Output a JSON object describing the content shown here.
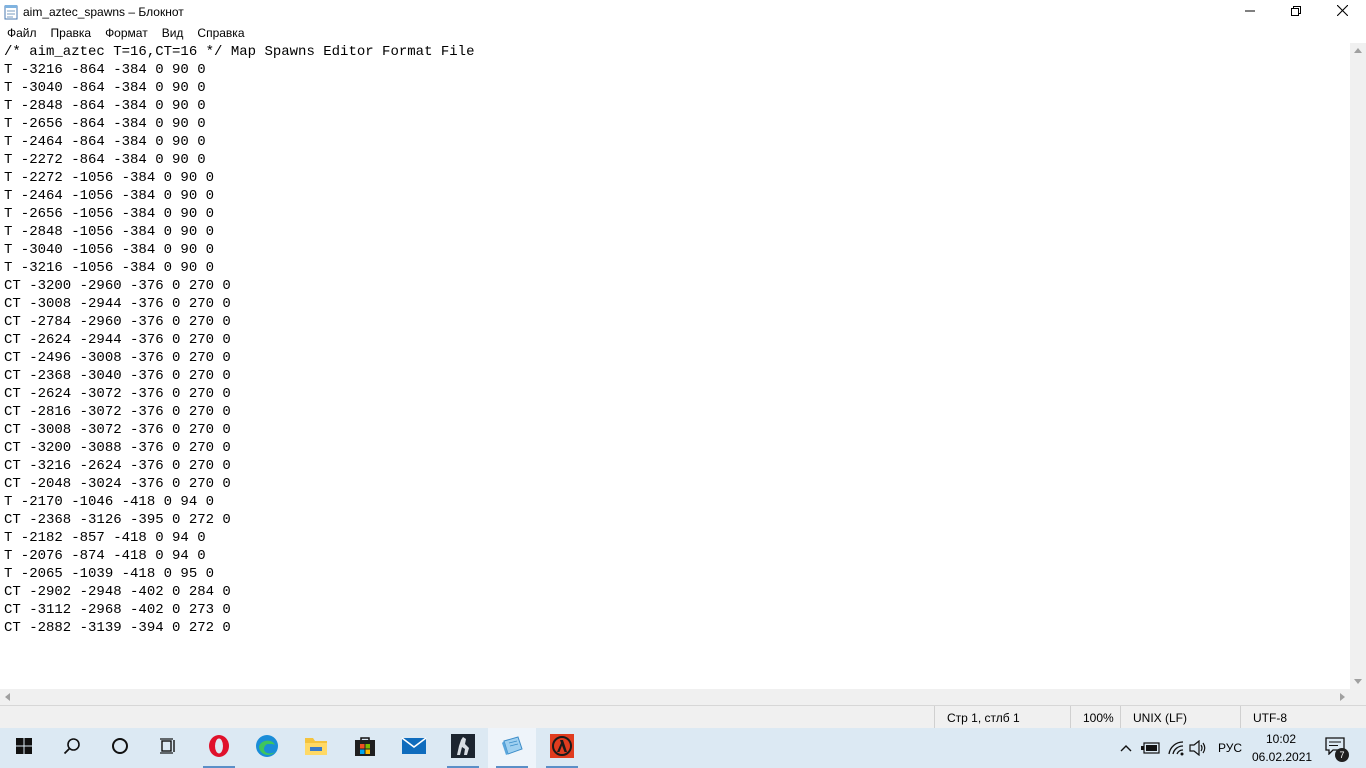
{
  "window": {
    "title": "aim_aztec_spawns – Блокнот",
    "icon": "notepad-icon",
    "controls": {
      "minimize": "minimize-icon",
      "maximize": "maximize-icon",
      "close": "close-icon"
    }
  },
  "menu": {
    "items": [
      "Файл",
      "Правка",
      "Формат",
      "Вид",
      "Справка"
    ]
  },
  "editor": {
    "lines": [
      "/* aim_aztec T=16,CT=16 */ Map Spawns Editor Format File",
      "T -3216 -864 -384 0 90 0",
      "T -3040 -864 -384 0 90 0",
      "T -2848 -864 -384 0 90 0",
      "T -2656 -864 -384 0 90 0",
      "T -2464 -864 -384 0 90 0",
      "T -2272 -864 -384 0 90 0",
      "T -2272 -1056 -384 0 90 0",
      "T -2464 -1056 -384 0 90 0",
      "T -2656 -1056 -384 0 90 0",
      "T -2848 -1056 -384 0 90 0",
      "T -3040 -1056 -384 0 90 0",
      "T -3216 -1056 -384 0 90 0",
      "CT -3200 -2960 -376 0 270 0",
      "CT -3008 -2944 -376 0 270 0",
      "CT -2784 -2960 -376 0 270 0",
      "CT -2624 -2944 -376 0 270 0",
      "CT -2496 -3008 -376 0 270 0",
      "CT -2368 -3040 -376 0 270 0",
      "CT -2624 -3072 -376 0 270 0",
      "CT -2816 -3072 -376 0 270 0",
      "CT -3008 -3072 -376 0 270 0",
      "CT -3200 -3088 -376 0 270 0",
      "CT -3216 -2624 -376 0 270 0",
      "CT -2048 -3024 -376 0 270 0",
      "T -2170 -1046 -418 0 94 0",
      "CT -2368 -3126 -395 0 272 0",
      "T -2182 -857 -418 0 94 0",
      "T -2076 -874 -418 0 94 0",
      "T -2065 -1039 -418 0 95 0",
      "CT -2902 -2948 -402 0 284 0",
      "CT -3112 -2968 -402 0 273 0",
      "CT -2882 -3139 -394 0 272 0"
    ]
  },
  "statusbar": {
    "position": "Стр 1, стлб 1",
    "zoom": "100%",
    "line_endings": "UNIX (LF)",
    "encoding": "UTF-8"
  },
  "taskbar": {
    "apps": [
      "start-icon",
      "search-icon",
      "cortana-icon",
      "task-view-icon",
      "opera-icon",
      "edge-icon",
      "file-explorer-icon",
      "store-icon",
      "mail-icon",
      "counter-strike-icon",
      "notepad-icon",
      "half-life-icon"
    ],
    "tray": {
      "language": "РУС",
      "time": "10:02",
      "date": "06.02.2021",
      "notifications_count": "7"
    }
  },
  "colors": {
    "taskbar_bg": "#dce9f3",
    "statusbar_bg": "#f0f0f0",
    "opera_red": "#e0112b",
    "edge_blue": "#1a8dd8",
    "explorer_yellow": "#f4c33d"
  }
}
